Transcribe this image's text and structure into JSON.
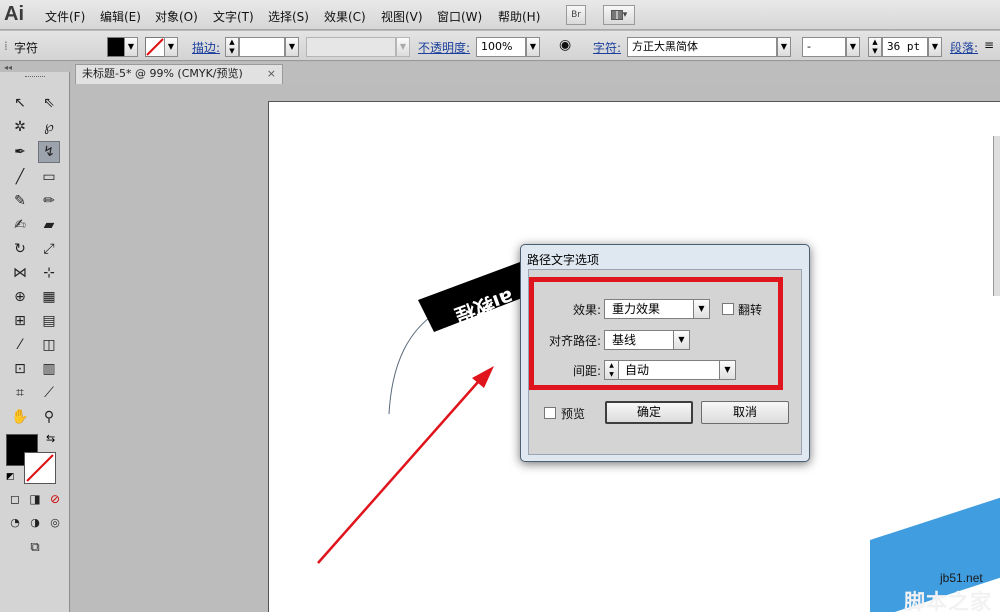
{
  "app": {
    "logo_text": "Ai"
  },
  "menu": [
    "文件(F)",
    "编辑(E)",
    "对象(O)",
    "文字(T)",
    "选择(S)",
    "效果(C)",
    "视图(V)",
    "窗口(W)",
    "帮助(H)"
  ],
  "menubar_buttons": {
    "bridge": "Br",
    "workspace_arrow": "▾"
  },
  "control_bar": {
    "panel_label": "字符",
    "stroke_label": "描边:",
    "opacity_label": "不透明度:",
    "opacity_value": "100%",
    "character_label": "字符:",
    "font_family": "方正大黑简体",
    "font_style": "-",
    "font_size": "36 pt",
    "paragraph_label": "段落:",
    "fill_color": "#000000",
    "stroke_color": "none"
  },
  "document": {
    "tab_title": "未标题-5* @ 99% (CMYK/预览)",
    "tab_close": "×",
    "path_text": "ai教程"
  },
  "dialog": {
    "title": "路径文字选项",
    "effect_label": "效果:",
    "effect_value": "重力效果",
    "flip_label": "翻转",
    "flip_checked": false,
    "align_label": "对齐路径:",
    "align_value": "基线",
    "spacing_label": "间距:",
    "spacing_value": "自动",
    "preview_label": "预览",
    "preview_checked": false,
    "ok_label": "确定",
    "cancel_label": "取消"
  },
  "annotation": {
    "highlight_color": "#e0141c",
    "arrow_color": "#e0141c"
  },
  "watermark": {
    "url": "jb51.net",
    "name": "脚本之家"
  }
}
